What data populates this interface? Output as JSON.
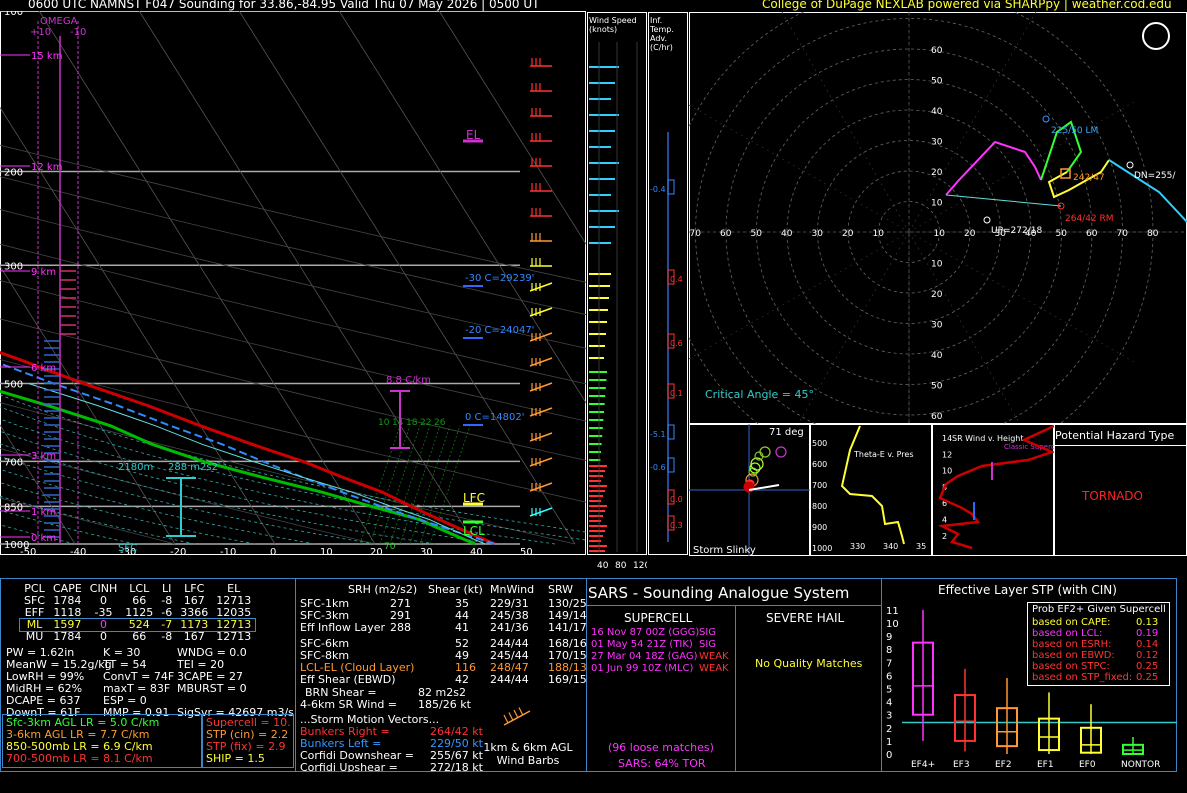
{
  "header": {
    "title": "0600 UTC NAMNST F047 Sounding for 33.86,-84.95 Valid  Thu 07 May 2026 | 0500 UT",
    "credit": "College of DuPage NEXLAB powered via SHARPpy | weather.cod.edu"
  },
  "colors": {
    "bg": "#000000",
    "temp": "#cc0000",
    "dew": "#00cc00",
    "parcel": "#3388ff",
    "omega": "#cc33cc",
    "cyan": "#33cccc",
    "yellow": "#ffff33",
    "frame": "#3a86c8"
  },
  "skewt": {
    "omega_label": "OMEGA",
    "omega_ticks": [
      "+10",
      "-10"
    ],
    "pressure_labels": [
      "100",
      "200",
      "300",
      "500",
      "700",
      "850",
      "1000"
    ],
    "temp_labels": [
      "-50",
      "-40",
      "-30",
      "-20",
      "-10",
      "0",
      "10",
      "20",
      "30",
      "40",
      "50"
    ],
    "height_labels": [
      "15 km",
      "12 km",
      "9 km",
      "6 km",
      "3 km",
      "1 km",
      "0 km"
    ],
    "el_label": "EL",
    "lfc_label": "LFC",
    "lcl_label": "LCL",
    "lapse_label": "8.8 C/km",
    "isotherm_labels": [
      "-30 C=29239'",
      "-20 C=24047'",
      "0 C=14802'"
    ],
    "wetbulb_labels": [
      "10",
      "14",
      "18",
      "22",
      "26"
    ],
    "height_flag": "2180m",
    "srh_flag": "288 m2s2",
    "sfc_label": "SFC",
    "theta_label": "70"
  },
  "windspeed": {
    "title": "Wind Speed (knots)",
    "ticks": [
      "40",
      "80",
      "120"
    ]
  },
  "advection": {
    "title": "Inf. Temp. Adv.(C/hr)",
    "values": [
      "-0.4",
      "0.4",
      "0.6",
      "0.1",
      "-5.1",
      "-0.6",
      "0.0",
      "0.3"
    ]
  },
  "hodograph": {
    "rings": [
      "10",
      "20",
      "30",
      "40",
      "50",
      "60"
    ],
    "xlabels": [
      "80",
      "70",
      "60",
      "50",
      "40",
      "30",
      "20",
      "10",
      "10",
      "20",
      "30",
      "40",
      "50",
      "60",
      "70",
      "80"
    ],
    "labels": {
      "lm": "225/50 LM",
      "rm": "264/42 RM",
      "mean": "242/47",
      "dn": "DN=255/",
      "up": "UP=272/18"
    },
    "critical_angle": "Critical Angle = 45°"
  },
  "storm_slinky": {
    "title": "Storm Slinky",
    "angle": "71 deg"
  },
  "theta_e": {
    "title": "Theta-E v. Pres",
    "ylabels": [
      "500",
      "600",
      "700",
      "800",
      "900",
      "1000"
    ],
    "xlabels": [
      "330",
      "340",
      "35"
    ]
  },
  "srwind": {
    "title": "SR Wind v. Height",
    "subtitle": "Classic Supercell",
    "ylabels": [
      "14",
      "12",
      "10",
      "8",
      "6",
      "4",
      "2"
    ]
  },
  "hazard": {
    "title": "Potential Hazard Type",
    "value": "TORNADO"
  },
  "parcel_table": {
    "headers": [
      "PCL",
      "CAPE",
      "CINH",
      "LCL",
      "LI",
      "LFC",
      "EL"
    ],
    "rows": [
      [
        "SFC",
        "1784",
        "0",
        "66",
        "-8",
        "167",
        "12713"
      ],
      [
        "EFF",
        "1118",
        "-35",
        "1125",
        "-6",
        "3366",
        "12035"
      ],
      [
        "ML",
        "1597",
        "0",
        "524",
        "-7",
        "1173",
        "12713"
      ],
      [
        "MU",
        "1784",
        "0",
        "66",
        "-8",
        "167",
        "12713"
      ]
    ]
  },
  "indices": {
    "col1": [
      "PW = 1.62in",
      "MeanW = 15.2g/kg",
      "LowRH = 99%",
      "MidRH = 62%",
      "DCAPE = 637",
      "DownT = 61F"
    ],
    "col2": [
      "K = 30",
      "TT = 54",
      "ConvT = 74F",
      "maxT = 83F",
      "ESP = 0",
      "MMP = 0.91"
    ],
    "col3": [
      "WNDG = 0.0",
      "TEI = 20",
      "3CAPE = 27",
      "MBURST = 0",
      "",
      "SigSvr = 42697 m3/s"
    ]
  },
  "lapse_rates": [
    {
      "text": "Sfc-3km AGL LR = 5.0 C/km",
      "color": "#33ff33"
    },
    {
      "text": "3-6km AGL LR = 7.7 C/km",
      "color": "#ff9933"
    },
    {
      "text": "850-500mb LR = 6.9 C/km",
      "color": "#ffff33"
    },
    {
      "text": "700-500mb LR = 8.1 C/km",
      "color": "#ff3333"
    }
  ],
  "composite": [
    {
      "text": "Supercell = 10.",
      "color": "#ff3333"
    },
    {
      "text": "STP (cin) = 2.2",
      "color": "#ff9933"
    },
    {
      "text": "STP (fix) = 2.9",
      "color": "#ff3333"
    },
    {
      "text": "SHIP = 1.5",
      "color": "#ffff33"
    }
  ],
  "kinematics": {
    "headers": [
      "SRH (m2/s2)",
      "Shear (kt)",
      "MnWind",
      "SRW"
    ],
    "rows": [
      {
        "name": "SFC-1km",
        "srh": "271",
        "shear": "35",
        "mn": "229/31",
        "srw": "130/25",
        "color": "#ffffff"
      },
      {
        "name": "SFC-3km",
        "srh": "291",
        "shear": "44",
        "mn": "245/38",
        "srw": "149/14",
        "color": "#ffffff"
      },
      {
        "name": "Eff Inflow Layer",
        "srh": "288",
        "shear": "41",
        "mn": "241/36",
        "srw": "141/17",
        "color": "#ffffff"
      },
      {
        "name": "SFC-6km",
        "srh": "",
        "shear": "52",
        "mn": "244/44",
        "srw": "168/16",
        "color": "#ffffff"
      },
      {
        "name": "SFC-8km",
        "srh": "",
        "shear": "49",
        "mn": "245/44",
        "srw": "170/15",
        "color": "#ffffff"
      },
      {
        "name": "LCL-EL (Cloud Layer)",
        "srh": "",
        "shear": "116",
        "mn": "248/47",
        "srw": "188/13",
        "color": "#ff9933"
      },
      {
        "name": "Eff Shear (EBWD)",
        "srh": "",
        "shear": "42",
        "mn": "244/44",
        "srw": "169/15",
        "color": "#ffffff"
      }
    ],
    "brn": "BRN Shear =",
    "brn_val": "82 m2s2",
    "srwind": "4-6km SR Wind =",
    "srwind_val": "185/26 kt",
    "motion_title": "...Storm Motion Vectors...",
    "motions": [
      {
        "name": "Bunkers Right =",
        "val": "264/42 kt",
        "color": "#ff3333"
      },
      {
        "name": "Bunkers Left =",
        "val": "229/50 kt",
        "color": "#3399ff"
      },
      {
        "name": "Corfidi Downshear =",
        "val": "255/67 kt",
        "color": "#ffffff"
      },
      {
        "name": "Corfidi Upshear =",
        "val": "272/18 kt",
        "color": "#ffffff"
      }
    ],
    "barbs_label": "1km & 6km AGL Wind Barbs"
  },
  "sars": {
    "title": "SARS - Sounding Analogue System",
    "supercell": "SUPERCELL",
    "hail": "SEVERE HAIL",
    "matches": [
      "16 Nov 87 00Z (GGG)",
      "01 May 54 21Z (TIK)",
      "27 Mar 04 18Z (GAG)",
      "01 Jun 99 10Z (MLC)"
    ],
    "match_tags": [
      "SIG",
      "SIG",
      "WEAK",
      "WEAK"
    ],
    "no_matches": "No Quality Matches",
    "loose": "(96 loose matches)",
    "tor": "SARS: 64% TOR"
  },
  "stp": {
    "title": "Effective Layer STP (with CIN)",
    "ylabels": [
      "11",
      "10",
      "9",
      "8",
      "7",
      "6",
      "5",
      "4",
      "3",
      "2",
      "1",
      "0"
    ],
    "categories": [
      "EF4+",
      "EF3",
      "EF2",
      "EF1",
      "EF0",
      "NONTOR"
    ],
    "prob_title": "Prob EF2+ Given Supercell",
    "prob_rows": [
      {
        "label": "based on CAPE:",
        "value": "0.13",
        "color": "#ffff33"
      },
      {
        "label": "based on LCL:",
        "value": "0.19",
        "color": "#ff33ff"
      },
      {
        "label": "based on ESRH:",
        "value": "0.14",
        "color": "#ff3333"
      },
      {
        "label": "based on EBWD:",
        "value": "0.12",
        "color": "#ff3333"
      },
      {
        "label": "based on STPC:",
        "value": "0.25",
        "color": "#ff3333"
      },
      {
        "label": "based on STP_fixed:",
        "value": "0.25",
        "color": "#ff3333"
      }
    ]
  },
  "chart_data": {
    "type": "line",
    "title": "0600 UTC NAMNST F047 Sounding for 33.86,-84.95",
    "xlabel": "",
    "ylabel": "",
    "ylim": [
      1000,
      100
    ],
    "xlim": [
      -50,
      50
    ],
    "series": [
      {
        "pressure": [
          1000,
          975,
          950,
          925,
          900,
          850,
          800,
          750,
          700,
          650,
          600,
          550,
          500,
          450,
          400,
          350,
          300,
          250,
          200,
          150,
          100
        ],
        "values": [
          22,
          21,
          20,
          19,
          18,
          16,
          14,
          11,
          8,
          4,
          0,
          -4,
          -9,
          -14,
          -20,
          -27,
          -35,
          -44,
          -53,
          -60,
          -58
        ]
      },
      {
        "pressure": [
          1000,
          975,
          950,
          925,
          900,
          850,
          800,
          750,
          700,
          650,
          600,
          550,
          500,
          450,
          400,
          350,
          300,
          250,
          200,
          150,
          100
        ],
        "values": [
          20,
          19,
          18,
          17,
          16,
          12,
          8,
          3,
          -2,
          -6,
          -9,
          -14,
          -20,
          -27,
          -33,
          -40,
          -48,
          -56,
          -64,
          -70,
          -75
        ]
      },
      {
        "pressure": [
          1000,
          950,
          900,
          850,
          800,
          750,
          700,
          650,
          600,
          550,
          500,
          450,
          400,
          350,
          300,
          250,
          200,
          150,
          100
        ],
        "values": [
          22,
          19,
          16,
          13,
          10,
          7,
          4,
          1,
          -3,
          -7,
          -12,
          -17,
          -23,
          -30,
          -38,
          -47,
          -56,
          -60,
          -58
        ]
      }
    ]
  }
}
